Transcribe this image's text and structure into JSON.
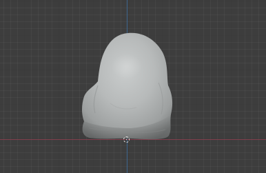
{
  "viewport": {
    "background_color": "#3d3d3d",
    "x_axis_color": "#8a3f4f",
    "z_axis_color": "#3f6f9e",
    "object_color": "#b9bcbc"
  },
  "icons": {
    "cursor": "3d-cursor-icon"
  }
}
